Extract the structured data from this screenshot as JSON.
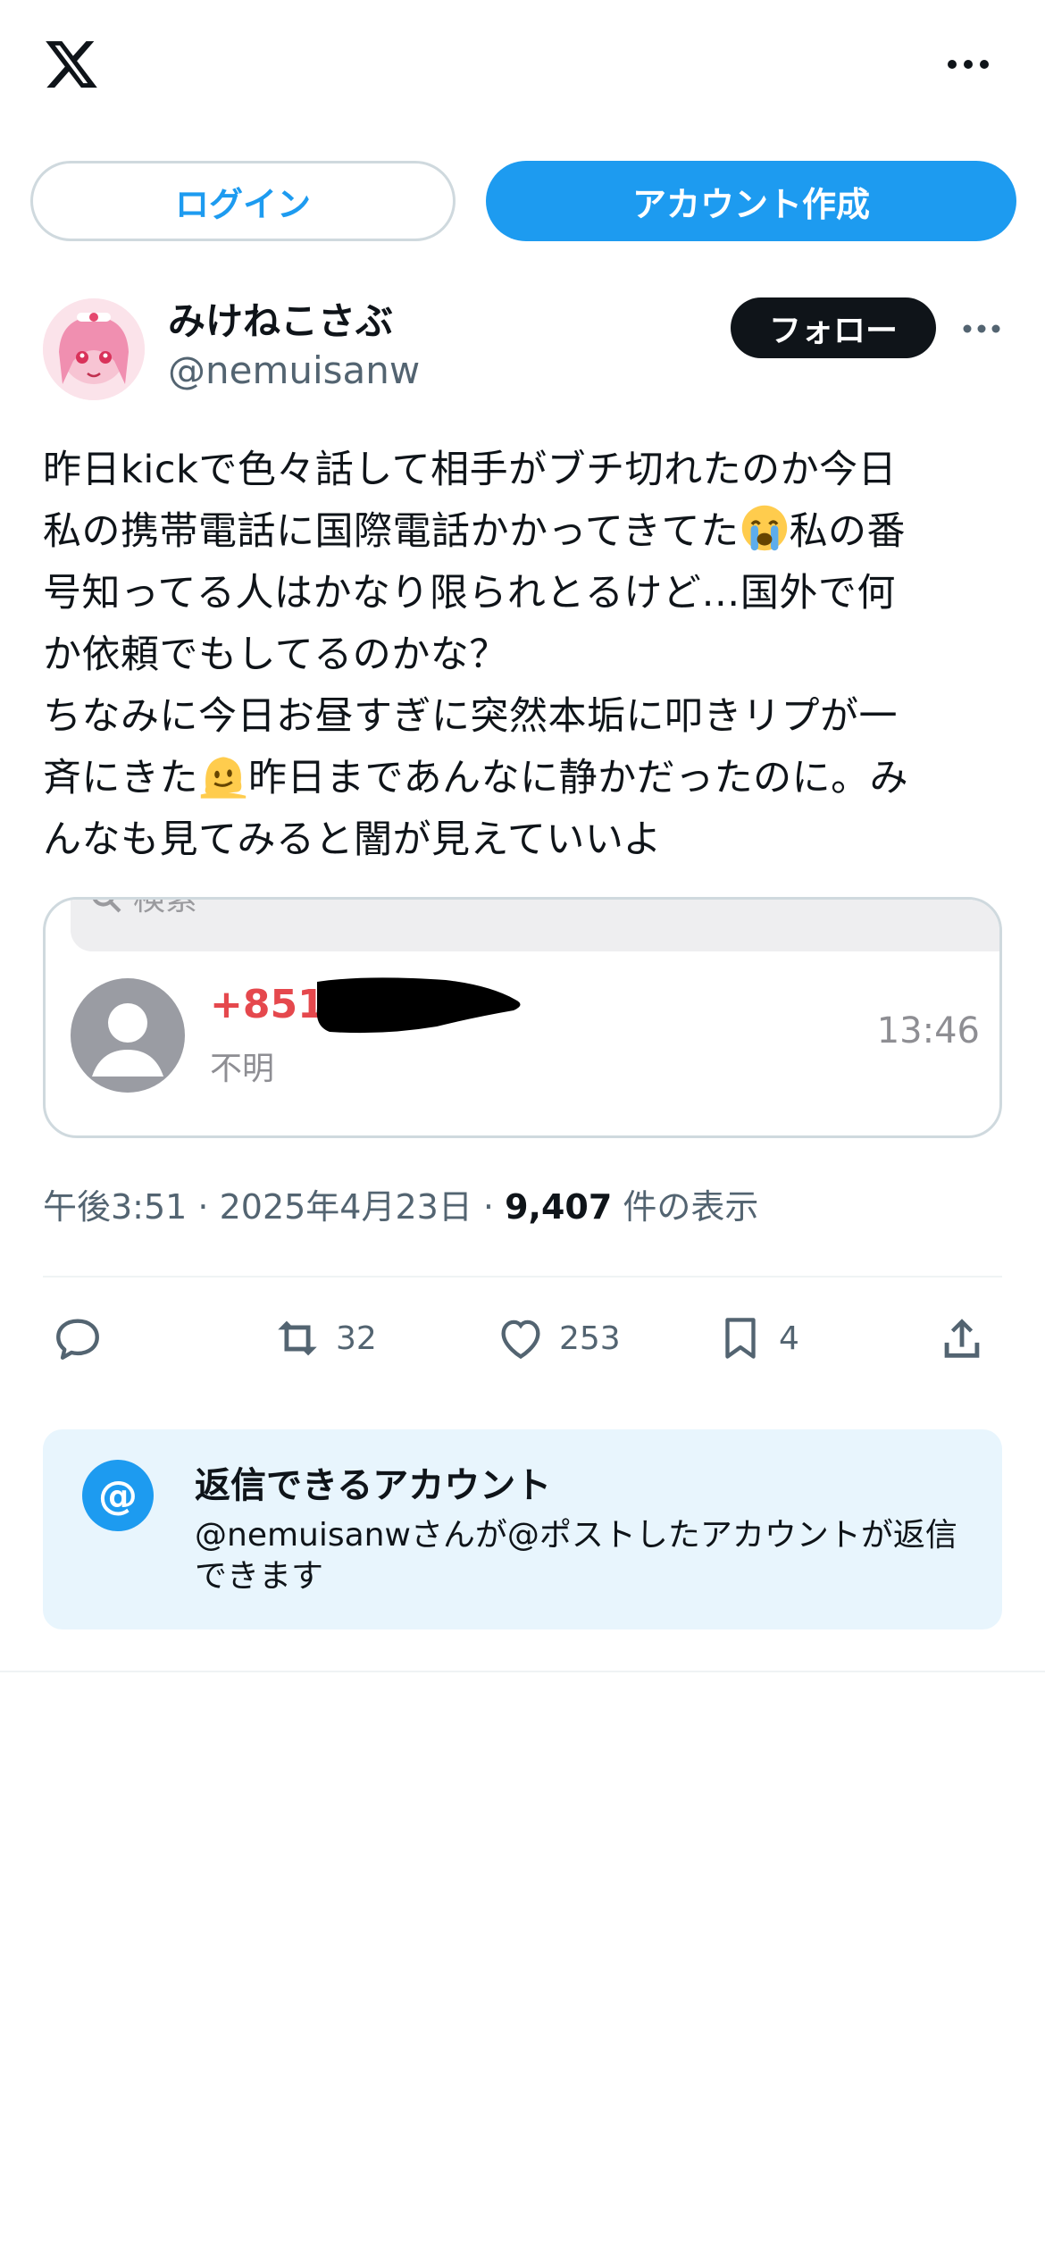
{
  "header": {
    "logo_icon": "x-logo-icon",
    "more_icon": "more-horizontal-icon",
    "login_label": "ログイン",
    "signup_label": "アカウント作成"
  },
  "author": {
    "display_name": "みけねこさぶ",
    "handle": "@nemuisanw",
    "follow_label": "フォロー"
  },
  "post": {
    "text_part1": "昨日kickで色々話して相手がブチ切れたのか今日\n私の携帯電話に国際電話かかってきてた",
    "emoji1": "loudly-crying-face",
    "text_part2": "私の番\n号知ってる人はかなり限られとるけど…国外で何\nか依頼でもしてるのかな？\nちなみに今日お昼すぎに突然本垢に叩きリプが一\n斉にきた",
    "emoji2": "melting-face",
    "text_part3": "昨日まであんなに静かだったのに。み\nんなも見てみると闇が見えていいよ"
  },
  "media": {
    "search_placeholder": "検索",
    "phone_number": "+851",
    "caller_label": "不明",
    "call_time": "13:46"
  },
  "meta": {
    "time": "午後3:51",
    "separator": " · ",
    "date": "2025年4月23日",
    "views_count": "9,407",
    "views_label": " 件の表示"
  },
  "actions": {
    "reply_icon": "reply-icon",
    "repost_count": "32",
    "like_count": "253",
    "bookmark_count": "4",
    "share_icon": "share-icon"
  },
  "reply_restriction": {
    "title": "返信できるアカウント",
    "description": "@nemuisanwさんが@ポストしたアカウントが返信できます",
    "icon_text": "@"
  },
  "colors": {
    "accent": "#1d9bf0",
    "text": "#0f1419",
    "secondary": "#536471",
    "reply_box_bg": "#e8f5fd"
  }
}
